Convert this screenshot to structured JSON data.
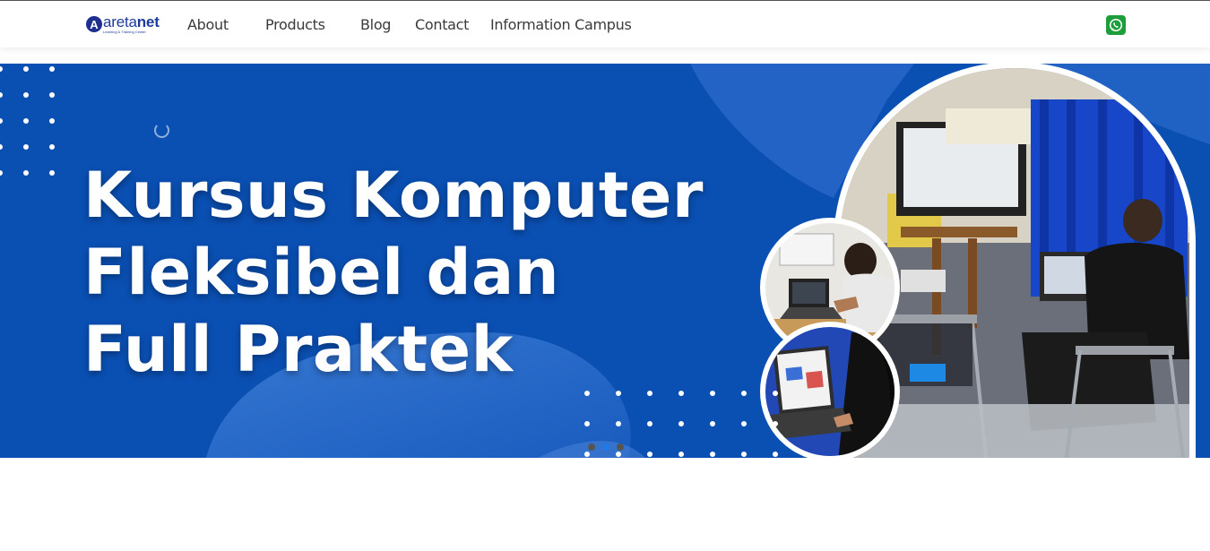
{
  "navbar": {
    "logo": {
      "badge": "A",
      "word_part1": "areta",
      "word_part2": "net",
      "tagline": "Learning & Training Center"
    },
    "items": [
      {
        "label": "About"
      },
      {
        "label": "Products"
      },
      {
        "label": "Blog"
      },
      {
        "label": "Contact"
      },
      {
        "label": "Information Campus"
      }
    ],
    "whatsapp_icon": "whatsapp-icon"
  },
  "hero": {
    "title_lines": [
      "Kursus Komputer",
      "Fleksibel dan",
      "Full Praktek"
    ],
    "background_color": "#0a4fb2",
    "accent_color": "#2b6fd0",
    "slide_indicators": {
      "count": 3,
      "active_index": 1
    },
    "images": [
      "photo-laptop-boy",
      "photo-laptop-screen",
      "photo-student-lab"
    ]
  },
  "colors": {
    "brand": "#1e3a9c",
    "whatsapp": "#1e9e3b",
    "indicator_active": "#1e7be6"
  }
}
